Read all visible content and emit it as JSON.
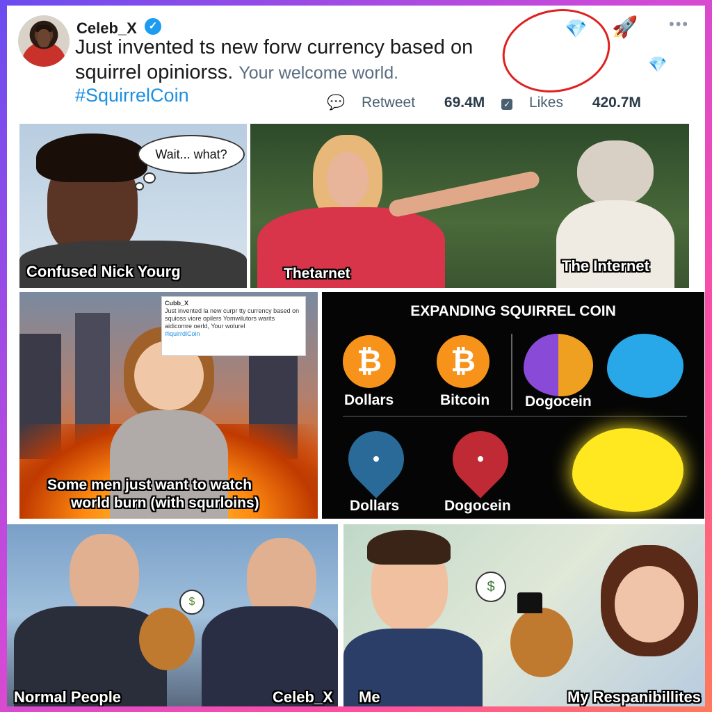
{
  "tweet": {
    "username": "Celeb_X",
    "line1": "Just invented ts new forw currency based on",
    "line2_main": "squirrel opiniorss.",
    "line2_sub": "Your welcome world.",
    "hashtag": "#SquirrelCoin",
    "retweet_label": "Retweet",
    "retweet_count": "69.4M",
    "likes_label": "Likes",
    "likes_count": "420.7M"
  },
  "panel1": {
    "thought": "Wait... what?",
    "caption": "Confused Nick Yourg"
  },
  "panel2": {
    "caption_left": "Thetarnet",
    "caption_right": "The Internet"
  },
  "panel3": {
    "caption_line1": "Some men just want to watch",
    "caption_line2": "world burn (with squrloins)",
    "mini_tweet": {
      "user": "Cubb_X",
      "text": "Just invented la new curpr tty currency based on squioss viore opilers Yomwilutors warits aidicomre oerld, Your wolurel",
      "tag": "#iquirrdiCoin"
    }
  },
  "panel4": {
    "title": "EXPANDING SQUIRREL COIN",
    "row1": [
      "Dollars",
      "Bitcoin",
      "Dogocein"
    ],
    "row2": [
      "Dollars",
      "Dogocein"
    ],
    "coin_symbol": "₿"
  },
  "panel5": {
    "left": "Normal People",
    "right": "Celeb_X",
    "symbol": "$"
  },
  "panel6": {
    "left": "Me",
    "right": "My Respanibillites",
    "symbol": "$"
  },
  "colors": {
    "accent": "#1d9bf0",
    "circle": "#e02020",
    "bitcoin": "#f7931a"
  }
}
